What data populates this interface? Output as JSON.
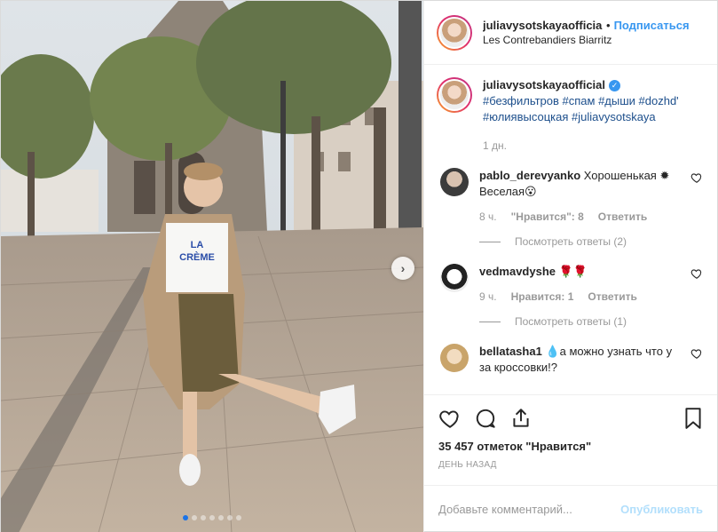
{
  "header": {
    "username": "juliavysotskayaofficial",
    "separator": "•",
    "follow_label": "Подписаться",
    "location": "Les Contrebandiers Biarritz"
  },
  "caption": {
    "username": "juliavysotskayaofficial",
    "hashtags_line1": "#безфильтров #спам #дыши #dozhd'",
    "hashtags_line2": "#юлиявысоцкая #juliavysotskaya",
    "time": "1 дн."
  },
  "comments": [
    {
      "username": "pablo_derevyanko",
      "text": "Хорошенькая ✹ Веселая😮",
      "time": "8 ч.",
      "likes": "\"Нравится\": 8",
      "reply_label": "Ответить",
      "view_replies": "Посмотреть ответы (2)"
    },
    {
      "username": "vedmavdyshe",
      "text": "🌹🌹",
      "time": "9 ч.",
      "likes": "Нравится: 1",
      "reply_label": "Ответить",
      "view_replies": "Посмотреть ответы (1)"
    },
    {
      "username": "bellatasha1",
      "text": "💧а можно узнать что у за кроссовки!?"
    }
  ],
  "actions": {
    "likes_text": "35 457 отметок \"Нравится\"",
    "posted_text": "ДЕНЬ НАЗАД"
  },
  "comment_box": {
    "placeholder": "Добавьте комментарий...",
    "publish_label": "Опубликовать"
  },
  "photo": {
    "bag_text_line1": "LA",
    "bag_text_line2": "CRÈME",
    "carousel_count": 7,
    "carousel_active": 1
  },
  "colors": {
    "accent": "#3897f0",
    "publish_disabled": "#b2dffc"
  }
}
